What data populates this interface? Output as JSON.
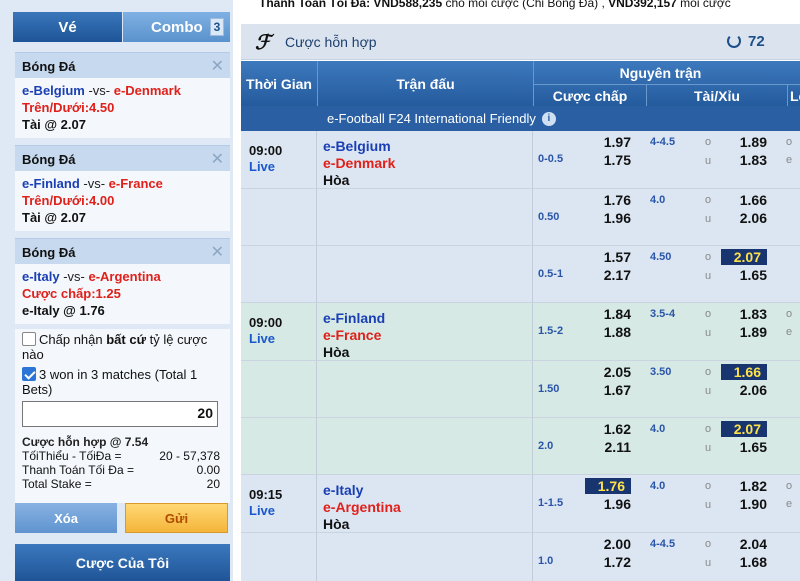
{
  "tabs": {
    "ve": "Vé",
    "combo": "Combo",
    "combo_count": "3"
  },
  "slips": [
    {
      "sport": "Bóng Đá",
      "home": "e-Belgium",
      "vs": " -vs- ",
      "away": "e-Denmark",
      "bet": "Trên/Dưới:4.50",
      "pick": "Tài @ 2.07"
    },
    {
      "sport": "Bóng Đá",
      "home": "e-Finland",
      "vs": " -vs- ",
      "away": "e-France",
      "bet": "Trên/Dưới:4.00",
      "pick": "Tài @ 2.07"
    },
    {
      "sport": "Bóng Đá",
      "home": "e-Italy",
      "vs": " -vs- ",
      "away": "e-Argentina",
      "bet": "Cược chấp:1.25",
      "pick": "e-Italy @ 1.76"
    }
  ],
  "options": {
    "accept_pre": "Chấp nhận ",
    "accept_bold": "bất cứ",
    "accept_post": " tỷ lệ cược nào",
    "won_label": "3 won in 3 matches (Total 1 Bets)",
    "stake_value": "20"
  },
  "summary": {
    "title": "Cược hỗn hợp @ 7.54",
    "min_max_label": "TốiThiểu - TốiĐa =",
    "min_max_value": "20 - 57,378",
    "max_pay_label": "Thanh Toán Tối Đa =",
    "max_pay_value": "0.00",
    "total_stake_label": "Total Stake =",
    "total_stake_value": "20"
  },
  "buttons": {
    "clear": "Xóa",
    "send": "Gửi",
    "my_bets": "Cược Của Tôi"
  },
  "marquee": {
    "bold1": "Thanh Toán Tối Đa: VND588,235",
    "text1": " cho mỗi cược (Chỉ Bóng Đá) , ",
    "bold2": "VND392,157",
    "text2": " mỗi cược"
  },
  "main": {
    "title": "Cược hỗn hợp",
    "refresh_count": "72"
  },
  "headers": {
    "time": "Thời Gian",
    "match": "Trận đấu",
    "full": "Nguyên trận",
    "handicap": "Cược chấp",
    "ou": "Tài/Xỉu",
    "edge": "Lẻ"
  },
  "league": "e-Football F24 International Friendly",
  "games": [
    {
      "time": "09:00",
      "status": "Live",
      "home": "e-Belgium",
      "away": "e-Denmark",
      "draw": "Hòa",
      "rows": [
        {
          "hdp": "0-0.5",
          "h1": "1.97",
          "h2": "1.75",
          "ou": "4-4.5",
          "o1": "1.89",
          "o2": "1.83",
          "hl_h": "",
          "hl_o": ""
        },
        {
          "hdp": "0.50",
          "h1": "1.76",
          "h2": "1.96",
          "ou": "4.0",
          "o1": "1.66",
          "o2": "2.06",
          "hl_h": "",
          "hl_o": ""
        },
        {
          "hdp": "0.5-1",
          "h1": "1.57",
          "h2": "2.17",
          "ou": "4.50",
          "o1": "2.07",
          "o2": "1.65",
          "hl_h": "",
          "hl_o": "o1"
        }
      ]
    },
    {
      "time": "09:00",
      "status": "Live",
      "home": "e-Finland",
      "away": "e-France",
      "draw": "Hòa",
      "rows": [
        {
          "hdp": "1.5-2",
          "h1": "1.84",
          "h2": "1.88",
          "ou": "3.5-4",
          "o1": "1.83",
          "o2": "1.89",
          "hl_h": "",
          "hl_o": ""
        },
        {
          "hdp": "1.50",
          "h1": "2.05",
          "h2": "1.67",
          "ou": "3.50",
          "o1": "1.66",
          "o2": "2.06",
          "hl_h": "",
          "hl_o": "o1"
        },
        {
          "hdp": "2.0",
          "h1": "1.62",
          "h2": "2.11",
          "ou": "4.0",
          "o1": "2.07",
          "o2": "1.65",
          "hl_h": "",
          "hl_o": "o1"
        }
      ]
    },
    {
      "time": "09:15",
      "status": "Live",
      "home": "e-Italy",
      "away": "e-Argentina",
      "draw": "Hòa",
      "rows": [
        {
          "hdp": "1-1.5",
          "h1": "1.76",
          "h2": "1.96",
          "ou": "4.0",
          "o1": "1.82",
          "o2": "1.90",
          "hl_h": "h1",
          "hl_o": ""
        },
        {
          "hdp": "1.0",
          "h1": "2.00",
          "h2": "1.72",
          "ou": "4-4.5",
          "o1": "2.04",
          "o2": "1.68",
          "hl_h": "",
          "hl_o": ""
        }
      ]
    }
  ],
  "labels": {
    "over": "o",
    "under": "u",
    "edge_o": "o",
    "edge_e": "e"
  }
}
